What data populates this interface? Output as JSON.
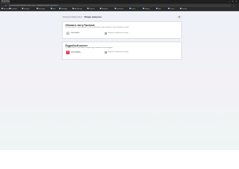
{
  "browser": {
    "tab_title": "Центр аккаунтов",
    "url": "accountscenter.facebook.com/account_settings/connected_experiences",
    "bookmarks": [
      "Приложения",
      "Facebook",
      "Instagram",
      "Messenger",
      "Meta",
      "WhatsApp",
      "Ads Manager",
      "Business",
      "Workplace",
      "Developers",
      "Oculus",
      "Settings",
      "Help",
      "Privacy",
      "Security"
    ]
  },
  "breadcrumb": {
    "parent": "Központi fiókkezelés",
    "separator": ">",
    "current": "Общие аккаунты"
  },
  "settings_icon": "settings-icon",
  "cards": [
    {
      "title": "Обновить ленту Facebook",
      "description": "Вы можете выбрать, в каких аккаунтах из этого Центра аккаунтов будут показываться ваши публикации и истории.",
      "account": {
        "name": "Имя Фамилия",
        "subtitle": "",
        "avatar": "profile-avatar"
      },
      "checkbox_label": "Подобрать отображение и рекламу"
    },
    {
      "title": "Подробный контент",
      "description": "Вы можете выбрать, какие аккаунты Instagram будут показываться в вашем профиле.",
      "account": {
        "name": "user_instagram",
        "subtitle": "В Центре аккаунтов",
        "avatar": "instagram-avatar"
      },
      "checkbox_label": "Подобрать отображение и рекламу"
    }
  ]
}
